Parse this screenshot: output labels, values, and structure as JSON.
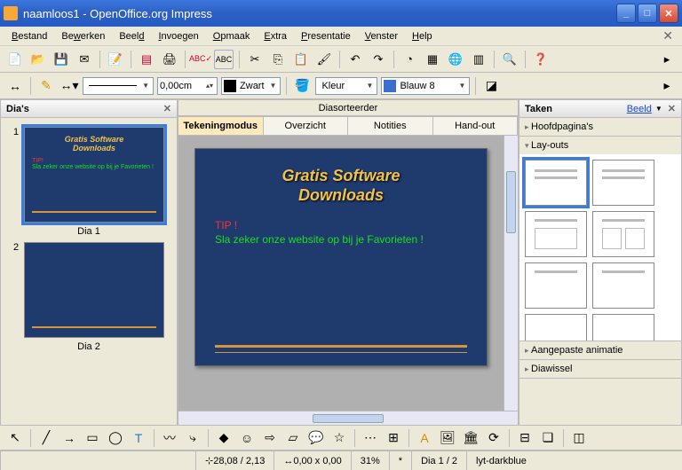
{
  "window": {
    "title": "naamloos1 - OpenOffice.org Impress"
  },
  "menu": [
    "Bestand",
    "Bewerken",
    "Beeld",
    "Invoegen",
    "Opmaak",
    "Extra",
    "Presentatie",
    "Venster",
    "Help"
  ],
  "menu_underline_idx": [
    0,
    1,
    4,
    0,
    1,
    0,
    0,
    0,
    0
  ],
  "line_width": "0,00cm",
  "color1": {
    "label": "Zwart",
    "hex": "#000000"
  },
  "fill_mode": "Kleur",
  "color2": {
    "label": "Blauw 8",
    "hex": "#3a6fd0"
  },
  "slides_panel": {
    "title": "Dia's"
  },
  "slides": [
    {
      "num": "1",
      "label": "Dia 1",
      "selected": true,
      "title1": "Gratis Software",
      "title2": "Downloads",
      "tip": "TIP!",
      "body": "Sla zeker onze website op bij je Favorieten !"
    },
    {
      "num": "2",
      "label": "Dia 2",
      "selected": false
    }
  ],
  "sorter_label": "Diasorteerder",
  "tabs": [
    {
      "label": "Tekeningmodus",
      "active": true
    },
    {
      "label": "Overzicht",
      "active": false
    },
    {
      "label": "Notities",
      "active": false
    },
    {
      "label": "Hand-out",
      "active": false
    }
  ],
  "canvas_slide": {
    "title1": "Gratis Software",
    "title2": "Downloads",
    "tip": "TIP !",
    "body": "Sla zeker onze website op bij je Favorieten !"
  },
  "tasks": {
    "title": "Taken",
    "view_link": "Beeld",
    "sections": [
      {
        "label": "Hoofdpagina's",
        "open": false
      },
      {
        "label": "Lay-outs",
        "open": true
      },
      {
        "label": "Aangepaste animatie",
        "open": false
      },
      {
        "label": "Diawissel",
        "open": false
      }
    ]
  },
  "status": {
    "pos": "28,08 / 2,13",
    "size": "0,00 x 0,00",
    "zoom": "31%",
    "mark": "*",
    "slide": "Dia 1 / 2",
    "layout": "lyt-darkblue"
  }
}
